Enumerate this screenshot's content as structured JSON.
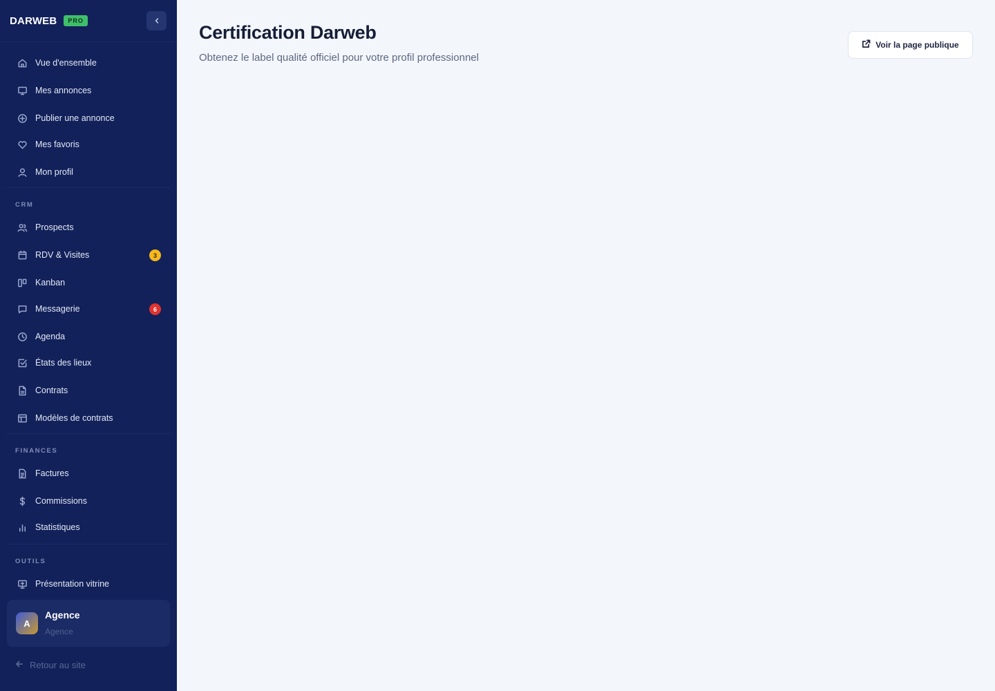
{
  "sidebar": {
    "brand": {
      "name": "DARWEB",
      "badge": "PRO"
    },
    "collapse_icon": "chevron-left-icon",
    "main_items": [
      {
        "label": "Vue d'ensemble",
        "icon": "home-icon"
      },
      {
        "label": "Mes annonces",
        "icon": "monitor-icon"
      },
      {
        "label": "Publier une annonce",
        "icon": "plus-circle-icon"
      },
      {
        "label": "Mes favoris",
        "icon": "heart-icon"
      },
      {
        "label": "Mon profil",
        "icon": "user-icon"
      }
    ],
    "crm": {
      "label": "CRM",
      "items": [
        {
          "label": "Prospects",
          "icon": "users-icon"
        },
        {
          "label": "RDV & Visites",
          "icon": "calendar-icon",
          "badge": "3"
        },
        {
          "label": "Kanban",
          "icon": "kanban-icon"
        },
        {
          "label": "Messagerie",
          "icon": "message-icon",
          "badge": "6"
        },
        {
          "label": "Agenda",
          "icon": "clock-icon"
        },
        {
          "label": "États des lieux",
          "icon": "check-square-icon"
        },
        {
          "label": "Contrats",
          "icon": "file-icon"
        },
        {
          "label": "Modèles de contrats",
          "icon": "layout-icon"
        }
      ]
    },
    "finances": {
      "label": "FINANCES",
      "items": [
        {
          "label": "Factures",
          "icon": "file-text-icon"
        },
        {
          "label": "Commissions",
          "icon": "dollar-icon"
        },
        {
          "label": "Statistiques",
          "icon": "bar-chart-icon"
        }
      ]
    },
    "outils": {
      "label": "OUTILS",
      "items": [
        {
          "label": "Présentation vitrine",
          "icon": "presentation-icon"
        }
      ]
    },
    "user": {
      "initial": "A",
      "name": "Agence",
      "role": "Agence"
    },
    "back_link": "Retour au site"
  },
  "header": {
    "title": "Certification Darweb",
    "subtitle": "Obtenez le label qualité officiel pour votre profil professionnel",
    "public_button": "Voir la page publique",
    "public_button_icon": "external-link-icon"
  },
  "colors": {
    "sidebar_bg": "#12215a",
    "page_bg": "#f3f6fb",
    "badge_yellow": "#f5b81c",
    "badge_red": "#e0332f",
    "pro_badge": "#3fbf6a"
  }
}
